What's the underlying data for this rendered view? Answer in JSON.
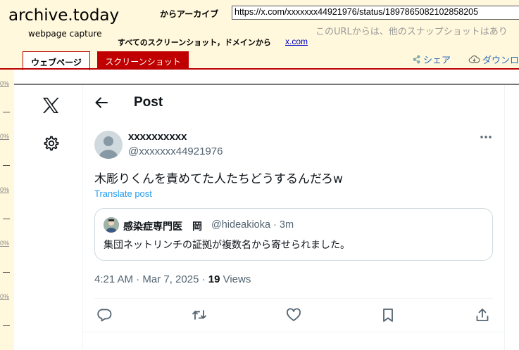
{
  "archive": {
    "title": "archive.today",
    "subtitle": "webpage capture",
    "url_label": "からアーカイブ",
    "url_value": "https://x.com/xxxxxxx44921976/status/1897865082102858205",
    "snapshot_hint": "このURLからは、他のスナップショットはあり",
    "all_snapshots_label": "すべてのスクリーンショット，ドメインから",
    "all_snapshots_domain": "x.com",
    "tab_webpage": "ウェブページ",
    "tab_screenshot": "スクリーンショット",
    "share_label": "シェア",
    "download_label": "ダウンロ"
  },
  "ruler": {
    "labels": [
      "0%",
      "0%",
      "0%",
      "0%",
      "0%"
    ]
  },
  "post_header": {
    "title": "Post"
  },
  "post": {
    "display_name": "xxxxxxxxxx",
    "handle": "@xxxxxxx44921976",
    "text": "木彫りくんを責めてた人たちどうするんだろw",
    "translate_label": "Translate post",
    "quote": {
      "name": "感染症専門医　岡",
      "handle_time": "@hideakioka · 3m",
      "text": "集団ネットリンチの証拠が複数名から寄せられました。"
    },
    "meta_time": "4:21 AM · Mar 7, 2025 · ",
    "meta_views_count": "19",
    "meta_views_label": " Views"
  },
  "colors": {
    "archive_bg": "#fff8dc",
    "archive_red": "#c00000",
    "link_blue": "#1d9bf0",
    "muted": "#536471"
  },
  "icons": [
    "x-logo-icon",
    "gear-icon",
    "back-arrow-icon",
    "more-icon",
    "reply-icon",
    "repost-icon",
    "like-icon",
    "bookmark-icon",
    "share-icon"
  ]
}
